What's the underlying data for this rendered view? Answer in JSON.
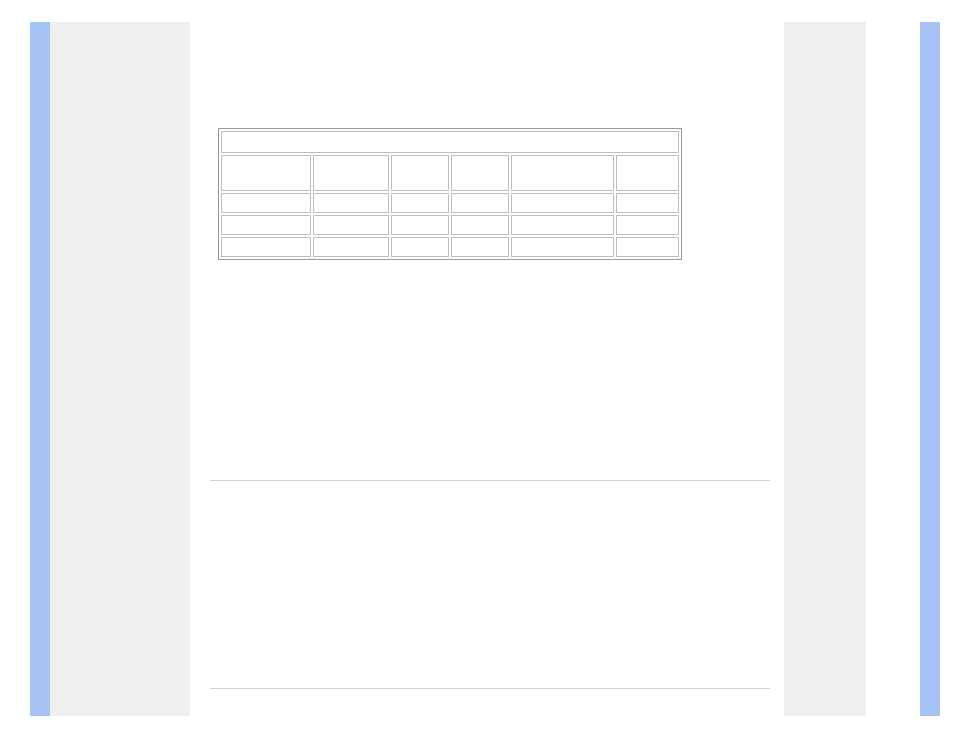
{
  "table": {
    "header_title": "",
    "columns": [
      "",
      "",
      "",
      "",
      "",
      ""
    ],
    "rows": [
      [
        "",
        "",
        "",
        "",
        "",
        ""
      ],
      [
        "",
        "",
        "",
        "",
        "",
        ""
      ],
      [
        "",
        "",
        "",
        "",
        "",
        ""
      ]
    ]
  }
}
